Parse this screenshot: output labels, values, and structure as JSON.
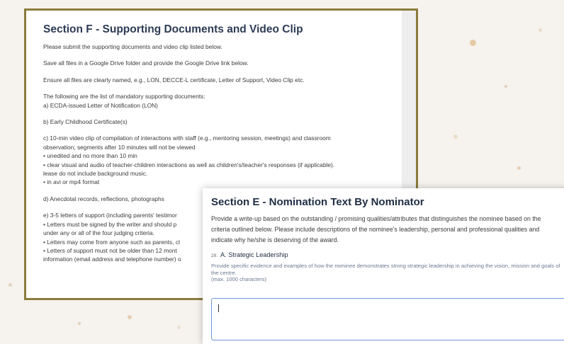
{
  "colors": {
    "page_bg": "#f6f3ee",
    "frame_border": "#8c7b3c",
    "title": "#2d3b55",
    "focus_border": "#6f96d8"
  },
  "section_f": {
    "title": "Section F - Supporting Documents and Video Clip",
    "lines": [
      "Please submit the supporting documents and video clip listed below.",
      "",
      "Save all files in a Google Drive folder and provide the Google Drive link below.",
      "",
      "Ensure all files are clearly named, e.g., LON, DECCE-L certificate, Letter of Support, Video Clip etc.",
      "",
      "The following are the list of mandatory supporting documents:",
      "a) ECDA-issued Letter of Notification (LON)",
      "",
      "b) Early Childhood Certificate(s)",
      "",
      "c) 10-min video clip of compilation of interactions with staff (e.g., mentoring session, meetings) and classroom",
      "observation; segments after 10 minutes will not be viewed",
      "• unedited and no more than 10 min",
      "• clear visual and audio of teacher-children interactions as well as children's/teacher's responses (if applicable).",
      "lease do not include background music.",
      "• in avi or mp4 format",
      "",
      "d) Anecdotal records, reflections, photographs",
      "",
      "e) 3-5 letters of support (including parents' testimor",
      "• Letters must be signed by the writer and should p",
      "under any or all of the four judging criteria.",
      "• Letters may come from anyone such as parents, cl",
      "• Letters of support must not be older than 12 mont",
      "information (email address and telephone number) o"
    ]
  },
  "section_e": {
    "title": "Section E - Nomination Text By Nominator",
    "description": "Provide a write-up based on the outstanding / promising qualities/attributes that distinguishes the nominee based on the criteria outlined below. Please include descriptions of the nominee's leadership, personal and professional qualities and indicate why he/she is deserving of the award.",
    "question": {
      "number": "29.",
      "label": "A. Strategic Leadership",
      "help": "Provide specific  evidence and  examples of how the nominee demonstrates strong strategic leadership in achieving the vision, mission and goals of the centre.",
      "limit": "(max. 1000 characters)",
      "value": ""
    }
  }
}
